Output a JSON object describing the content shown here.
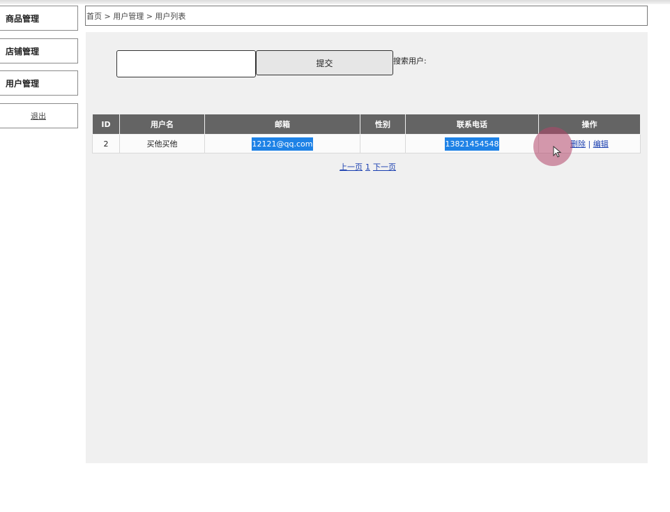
{
  "sidebar": {
    "items": [
      {
        "label": "商品管理"
      },
      {
        "label": "店铺管理"
      },
      {
        "label": "用户管理"
      }
    ],
    "logout": "退出"
  },
  "breadcrumb": "首页 > 用户管理 > 用户列表",
  "search": {
    "value": "",
    "placeholder": "",
    "submit_label": "提交",
    "label": "搜索用户:"
  },
  "table": {
    "headers": [
      "ID",
      "用户名",
      "邮箱",
      "性别",
      "联系电话",
      "操作"
    ],
    "rows": [
      {
        "id": "2",
        "username": "买他买他",
        "email": "12121@qq.com",
        "gender": "",
        "phone": "13821454548",
        "delete": "删除",
        "separator": "|",
        "edit": "编辑"
      }
    ]
  },
  "pager": {
    "prev": "上一页",
    "page": "1",
    "next": "下一页"
  },
  "colors": {
    "header_bg": "#646464",
    "selection": "#1e82e6",
    "link": "#1a3fb0",
    "cursor_highlight": "#b24669"
  },
  "icons": [
    "mouse-pointer-icon"
  ]
}
